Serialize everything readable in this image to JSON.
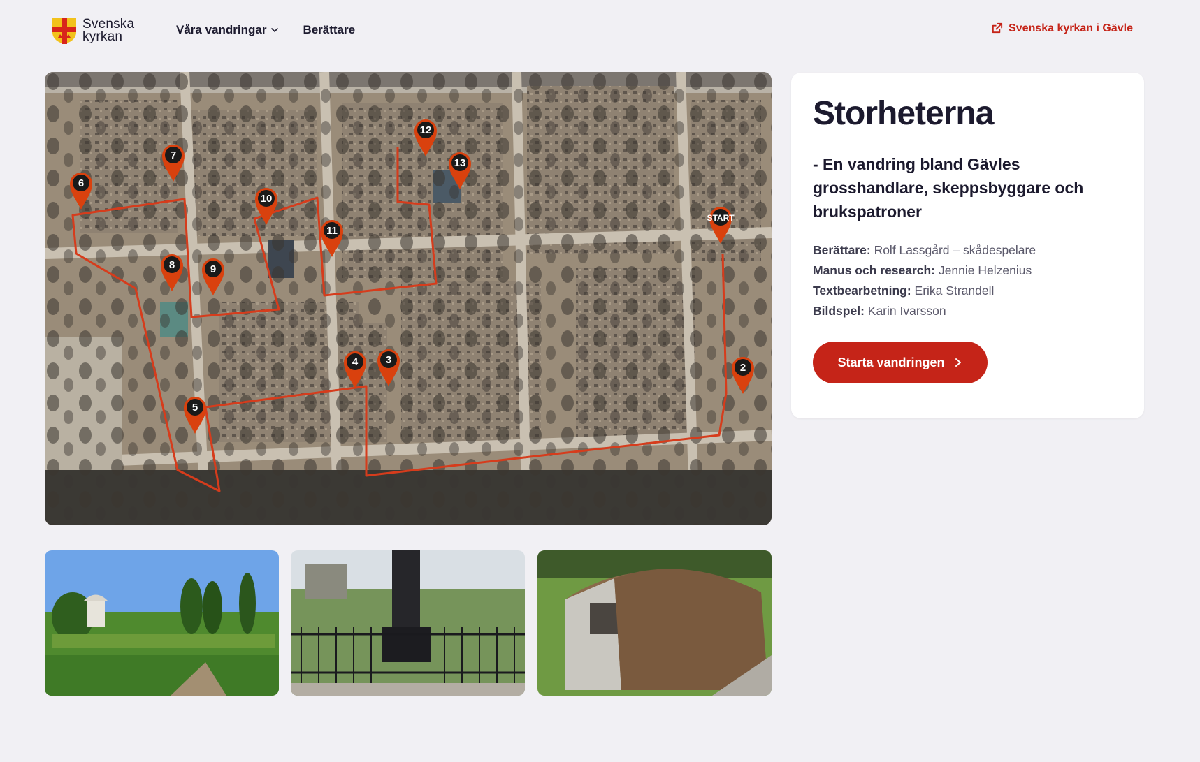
{
  "header": {
    "logo": {
      "line1": "Svenska",
      "line2": "kyrkan"
    },
    "nav": [
      {
        "label": "Våra vandringar",
        "has_dropdown": true
      },
      {
        "label": "Berättare",
        "has_dropdown": false
      }
    ],
    "external_link": {
      "label": "Svenska kyrkan i Gävle",
      "icon": "external-link-icon"
    }
  },
  "map": {
    "pins": [
      "START",
      "2",
      "3",
      "4",
      "5",
      "6",
      "7",
      "8",
      "9",
      "10",
      "11",
      "12",
      "13"
    ],
    "route_color": "#d63c1c",
    "pin_color": "#d9410e"
  },
  "walk": {
    "title": "Storheterna",
    "subtitle": "- En vandring bland Gävles grosshandlare, skeppsbyggare och brukspatroner",
    "credits": [
      {
        "label": "Berättare:",
        "value": "Rolf Lassgård – skådespelare"
      },
      {
        "label": "Manus och research:",
        "value": "Jennie Helzenius"
      },
      {
        "label": "Textbearbetning:",
        "value": "Erika Strandell"
      },
      {
        "label": "Bildspel:",
        "value": "Karin Ivarsson"
      }
    ],
    "cta": "Starta vandringen"
  },
  "thumbnails": [
    "garden-photo",
    "iron-fence-grave-photo",
    "vault-tomb-photo"
  ],
  "colors": {
    "accent": "#c52418",
    "background": "#f1f0f4",
    "card": "#ffffff",
    "text": "#1c1a2e"
  }
}
